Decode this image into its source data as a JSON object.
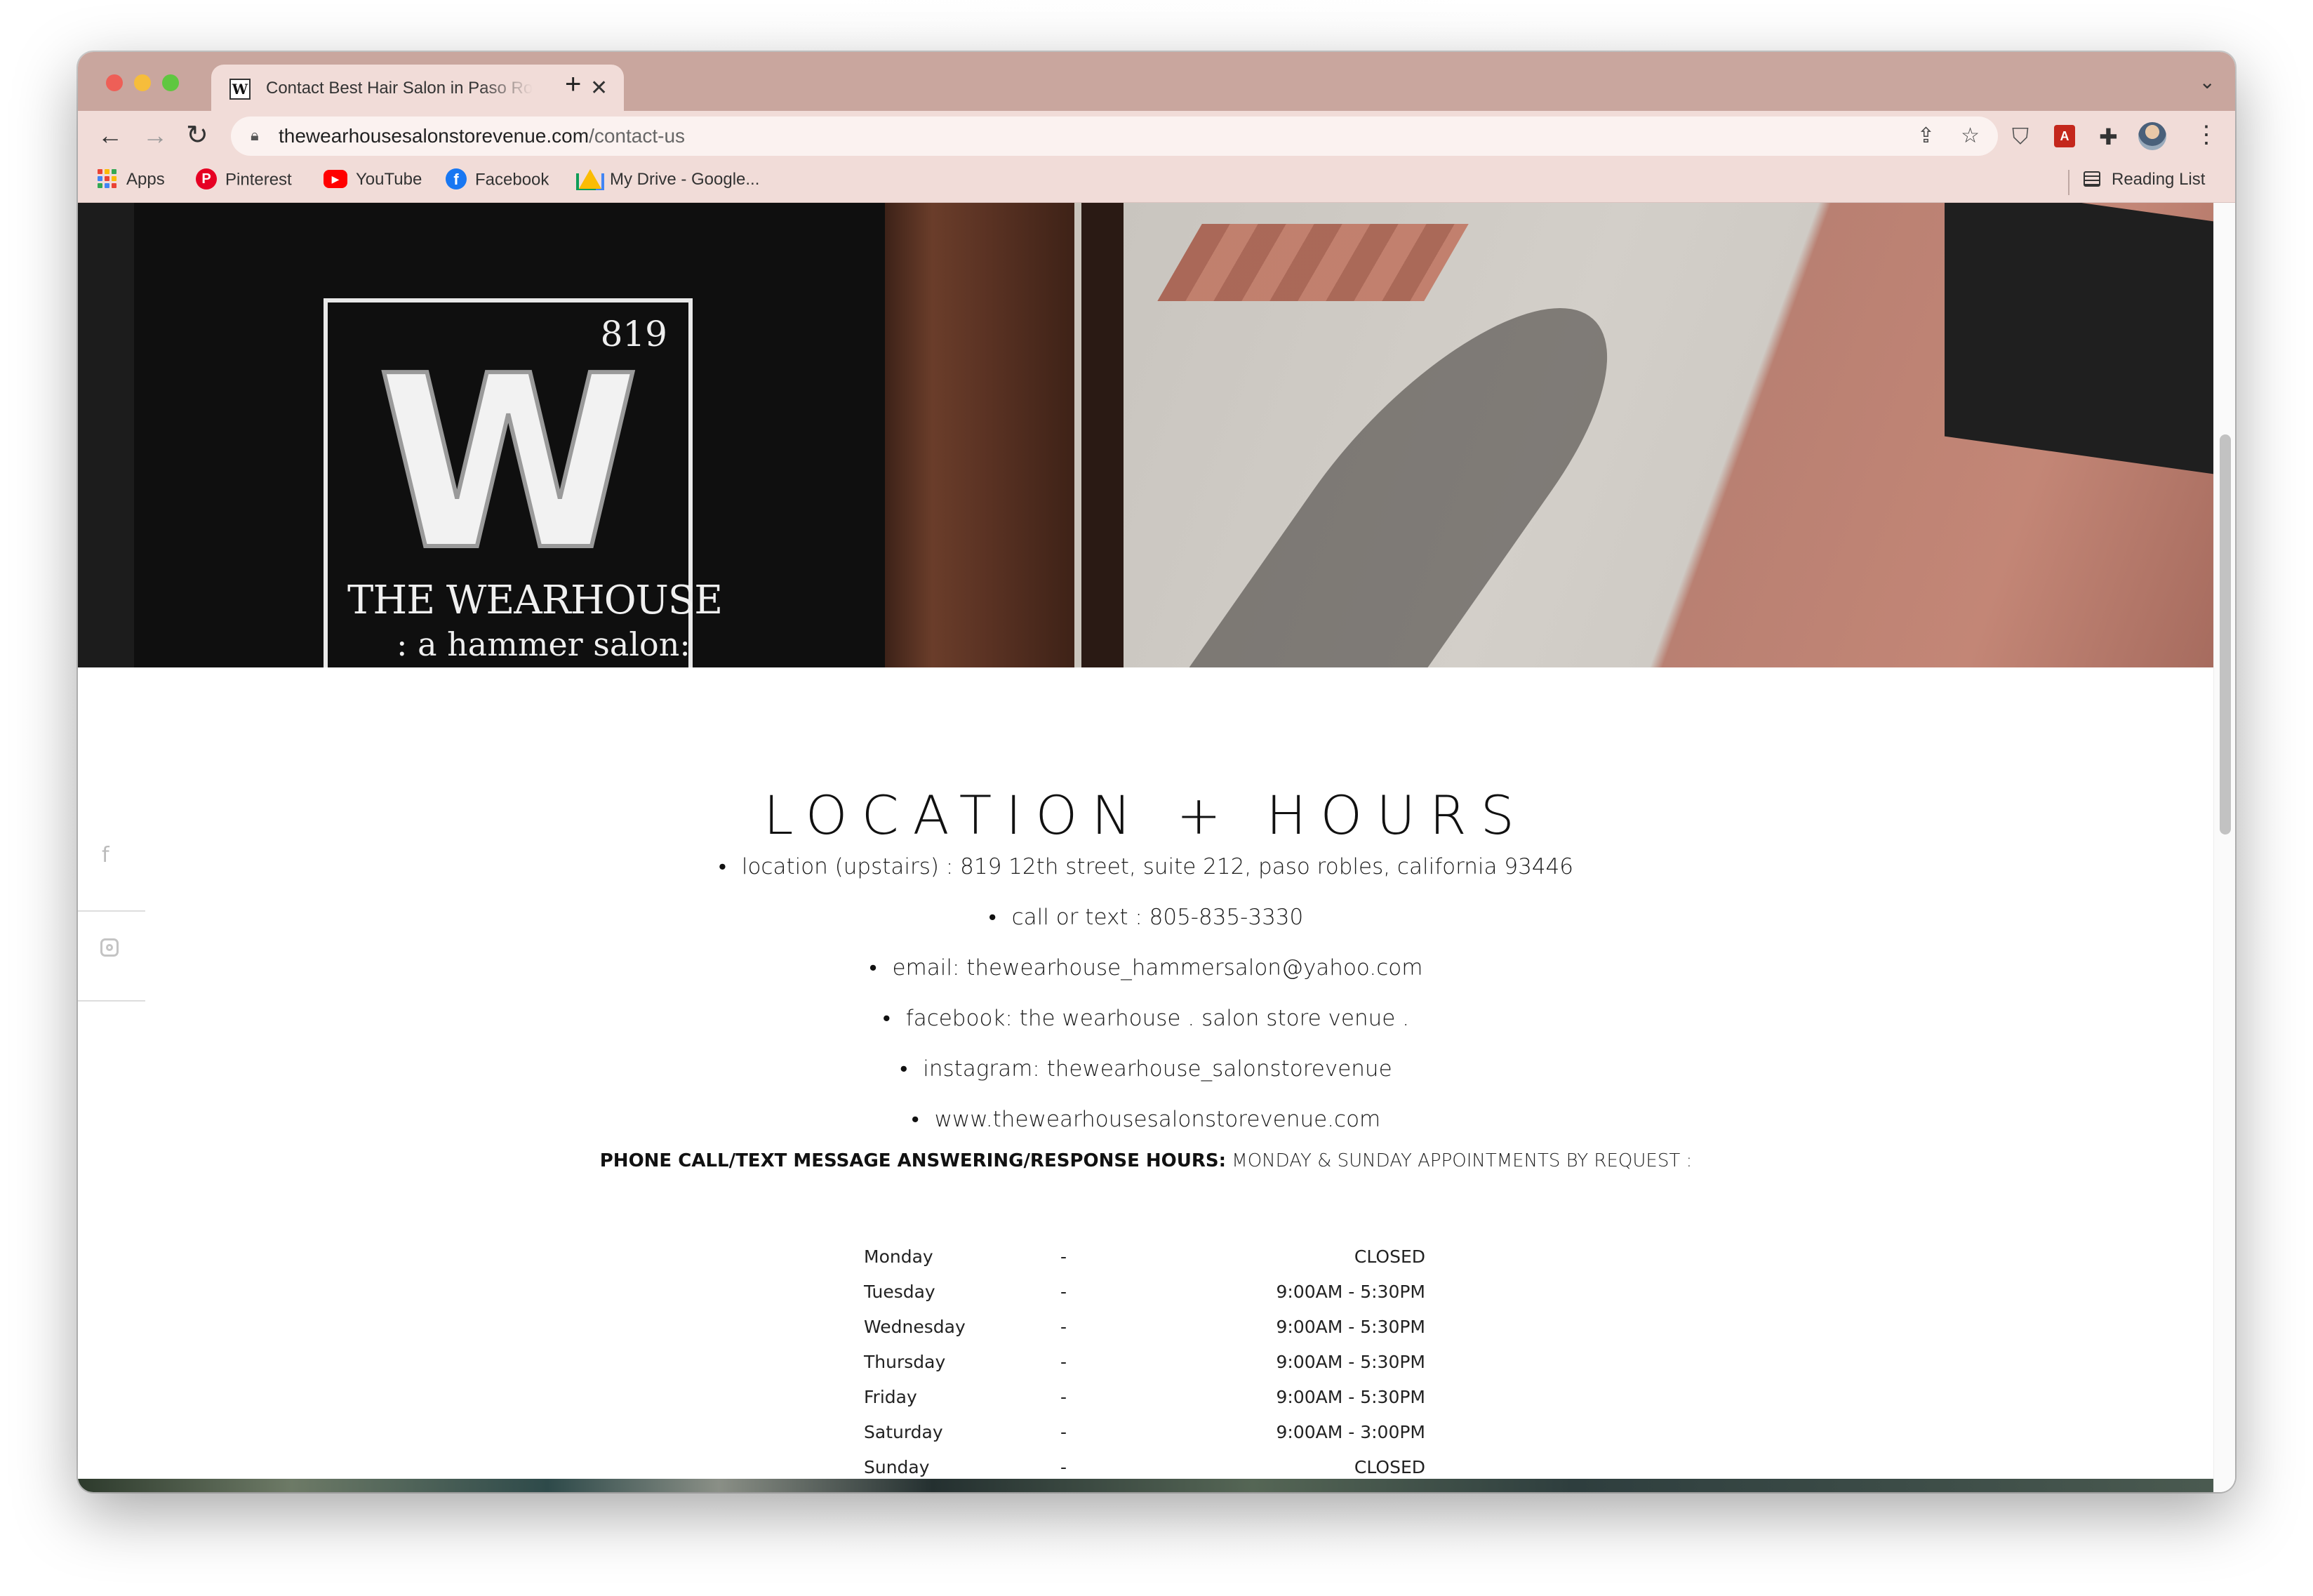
{
  "browser": {
    "tab_title": "Contact Best Hair Salon in Paso Robles",
    "tab_favicon": "W",
    "tab_close_glyph": "✕",
    "new_tab_glyph": "+",
    "tab_menu_glyph": "⌄",
    "url_domain": "thewearhousesalonstorevenue.com",
    "url_path": "/contact-us",
    "nav": {
      "back_glyph": "←",
      "forward_glyph": "→",
      "reload_glyph": "↻"
    },
    "bookmarks": [
      {
        "label": "Apps",
        "icon": "apps-grid-icon"
      },
      {
        "label": "Pinterest",
        "icon": "pinterest-icon"
      },
      {
        "label": "YouTube",
        "icon": "youtube-icon"
      },
      {
        "label": "Facebook",
        "icon": "facebook-icon"
      },
      {
        "label": "My Drive - Google...",
        "icon": "google-drive-icon"
      }
    ],
    "reading_list_label": "Reading List",
    "extensions": [
      "shield-icon",
      "pdf-icon",
      "puzzle-icon",
      "profile-avatar"
    ]
  },
  "hero": {
    "sign_number": "819",
    "sign_letter": "W",
    "sign_name": "THE WEARHOUSE",
    "sign_tagline": ": a hammer salon:"
  },
  "social": {
    "facebook_glyph": "f"
  },
  "content": {
    "heading": "LOCATION + HOURS",
    "info": [
      "location (upstairs) : 819 12th street, suite 212, paso robles, california 93446",
      "call or text : 805-835-3330",
      "email: thewearhouse_hammersalon@yahoo.com",
      "facebook: the wearhouse . salon store venue .",
      "instagram: thewearhouse_salonstorevenue",
      "www.thewearhousesalonstorevenue.com"
    ],
    "hours_note_bold": "PHONE CALL/TEXT MESSAGE ANSWERING/RESPONSE HOURS:",
    "hours_note_rest": " MONDAY & SUNDAY APPOINTMENTS BY REQUEST :",
    "hours": [
      {
        "day": "Monday",
        "sep": "-",
        "time": "CLOSED"
      },
      {
        "day": "Tuesday",
        "sep": "-",
        "time": "9:00AM - 5:30PM"
      },
      {
        "day": "Wednesday",
        "sep": "-",
        "time": "9:00AM - 5:30PM"
      },
      {
        "day": "Thursday",
        "sep": "-",
        "time": "9:00AM - 5:30PM"
      },
      {
        "day": "Friday",
        "sep": "-",
        "time": "9:00AM - 5:30PM"
      },
      {
        "day": "Saturday",
        "sep": "-",
        "time": "9:00AM - 3:00PM"
      },
      {
        "day": "Sunday",
        "sep": "-",
        "time": "CLOSED"
      }
    ]
  },
  "colors": {
    "tabstrip": "#c9a69e",
    "toolbar": "#f1dcd8",
    "text": "#1a1a1a"
  }
}
